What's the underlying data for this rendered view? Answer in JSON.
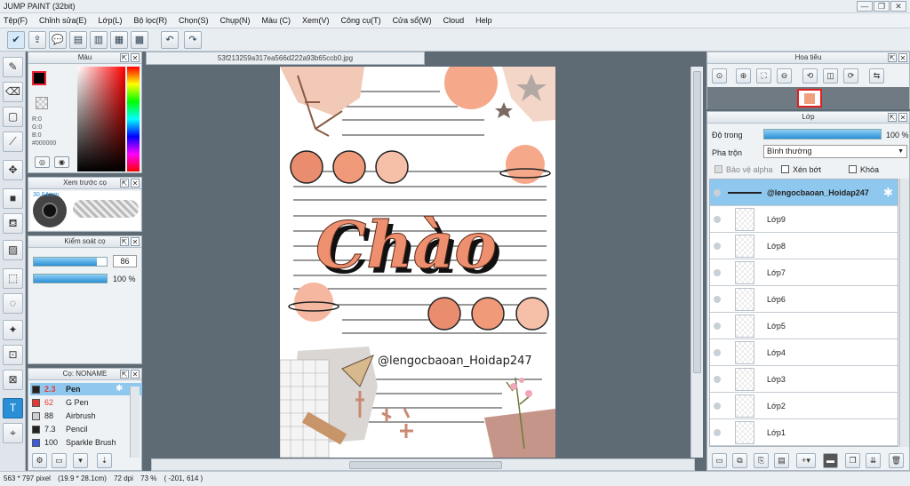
{
  "window": {
    "title": "JUMP PAINT (32bit)",
    "min": "—",
    "max": "❐",
    "close": "✕"
  },
  "menu": [
    "Tệp(F)",
    "Chỉnh sửa(E)",
    "Lớp(L)",
    "Bộ lọc(R)",
    "Chọn(S)",
    "Chụp(N)",
    "Màu (C)",
    "Xem(V)",
    "Công cụ(T)",
    "Cửa sổ(W)",
    "Cloud",
    "Help"
  ],
  "document": {
    "tab": "53f213259a317ea566d222a93b65ccb0.jpg"
  },
  "color_panel": {
    "title": "Màu",
    "r": "R:0",
    "g": "G:0",
    "b": "B:0",
    "hex": "#000000"
  },
  "brush_preview": {
    "title": "Xem trước cọ",
    "size": "30.64mm"
  },
  "brush_control": {
    "title": "Kiểm soát cọ",
    "size": "86",
    "opacity": "100 %",
    "size_level": 0.86,
    "opacity_level": 1.0
  },
  "brush_list": {
    "title": "Cọ: NONAME",
    "items": [
      {
        "size": "2.3",
        "name": "Pen",
        "color": "#222222"
      },
      {
        "size": "62",
        "name": "G Pen",
        "color": "#e53935"
      },
      {
        "size": "88",
        "name": "Airbrush",
        "color": "#d0d0d0"
      },
      {
        "size": "7.3",
        "name": "Pencil",
        "color": "#222222"
      },
      {
        "size": "100",
        "name": "Sparkle Brush",
        "color": "#3b5bdb"
      }
    ]
  },
  "navigator": {
    "title": "Hoa tiêu"
  },
  "layer_panel": {
    "title": "Lớp",
    "opacity_label": "Độ trong",
    "opacity_value": "100 %",
    "opacity_level": 1.0,
    "blend_label": "Pha trộn",
    "blend_value": "Bình thường",
    "protect_alpha": "Bảo vệ alpha",
    "clipping": "Xén bớt",
    "lock": "Khóa",
    "layers": [
      "@lengocbaoan_Hoidap247",
      "Lớp9",
      "Lớp8",
      "Lớp7",
      "Lớp6",
      "Lớp5",
      "Lớp4",
      "Lớp3",
      "Lớp2",
      "Lớp1"
    ]
  },
  "canvas_art": {
    "headline": "Chào",
    "handle": "@lengocbaoan_Hoidap247"
  },
  "status": {
    "size": "563 * 797 pixel",
    "cm": "(19.9 * 28.1cm)",
    "dpi": "72 dpi",
    "zoom": "73 %",
    "coords": "( -201, 614 )"
  },
  "colors": {
    "accent": "#2a8fd6",
    "peach": "#f0a07f",
    "selected_layer": "#8fc8ef"
  }
}
